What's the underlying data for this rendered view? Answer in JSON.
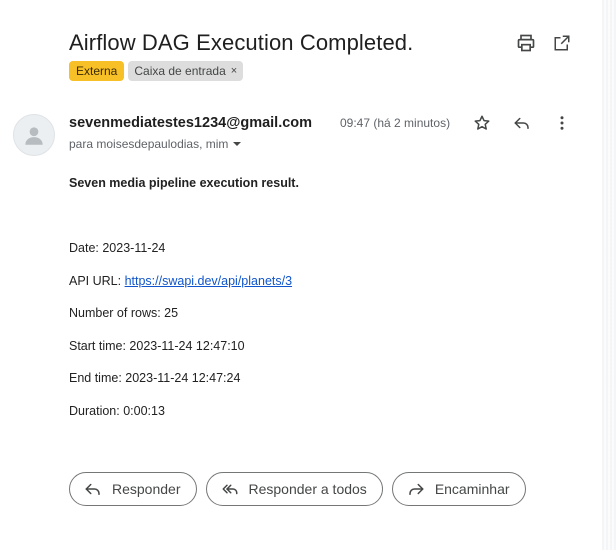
{
  "email": {
    "subject": "Airflow DAG Execution Completed.",
    "labels": {
      "external": "Externa",
      "inbox": "Caixa de entrada",
      "inbox_remove": "×"
    },
    "sender": "sevenmediatestes1234@gmail.com",
    "recipients": "para moisesdepaulodias, mim",
    "time": "09:47 (há 2 minutos)",
    "body": {
      "heading": "Seven media pipeline execution result.",
      "date_line": "Date: 2023-11-24",
      "api_label": "API URL: ",
      "api_url": "https://swapi.dev/api/planets/3",
      "rows_line": "Number of rows: 25",
      "start_line": "Start time: 2023-11-24 12:47:10",
      "end_line": "End time: 2023-11-24 12:47:24",
      "duration_line": "Duration: 0:00:13"
    }
  },
  "actions": {
    "reply": "Responder",
    "reply_all": "Responder a todos",
    "forward": "Encaminhar"
  },
  "icons": {
    "print": "print-icon",
    "open_new": "open-in-new-icon",
    "star": "star-icon",
    "reply": "reply-icon",
    "more": "more-vert-icon",
    "avatar": "person-icon",
    "dropdown": "caret-down-icon"
  },
  "colors": {
    "external_chip": "#f6c026",
    "inbox_chip": "#dddddd",
    "link": "#1155cc",
    "button_border": "#747775"
  }
}
